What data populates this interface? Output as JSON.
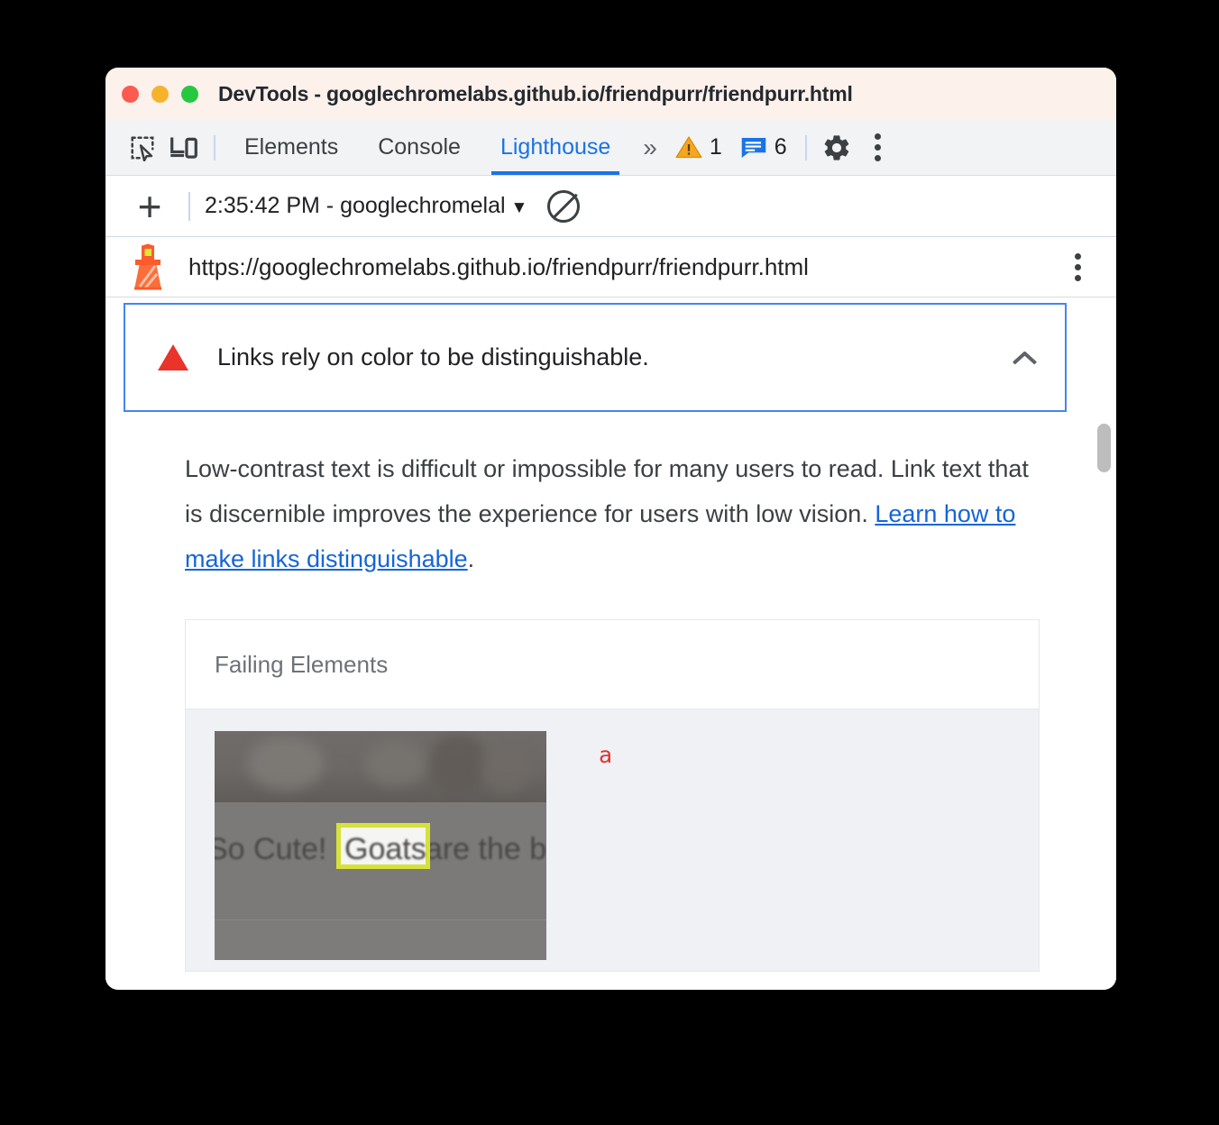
{
  "window": {
    "title": "DevTools - googlechromelabs.github.io/friendpurr/friendpurr.html",
    "traffic_lights": [
      "close",
      "minimize",
      "zoom"
    ]
  },
  "devtools_tabs": {
    "inspect_icon": "inspect-element-icon",
    "device_icon": "device-toolbar-icon",
    "items": [
      {
        "label": "Elements",
        "active": false
      },
      {
        "label": "Console",
        "active": false
      },
      {
        "label": "Lighthouse",
        "active": true
      }
    ],
    "more_tabs_icon": "chevron-double-right-icon",
    "warning_count": "1",
    "message_count": "6",
    "settings_icon": "gear-icon",
    "menu_icon": "kebab-menu-icon",
    "active_tab_color": "#1a73e8"
  },
  "lighthouse_toolbar": {
    "new_report_icon": "plus-icon",
    "report_selector_value": "2:35:42 PM - googlechromelal",
    "dropdown_caret_icon": "caret-down-icon",
    "clear_icon": "no-entry-icon"
  },
  "url_bar": {
    "logo_icon": "lighthouse-icon",
    "url": "https://googlechromelabs.github.io/friendpurr/friendpurr.html",
    "menu_icon": "kebab-menu-icon"
  },
  "audit": {
    "severity_icon": "red-warning-triangle-icon",
    "title": "Links rely on color to be distinguishable.",
    "collapse_icon": "chevron-up-icon",
    "description_before": "Low-contrast text is difficult or impossible for many users to read. Link text that is discernible improves the experience for users with low vision. ",
    "link_text": "Learn how to make links distinguishable",
    "description_after": ".",
    "border_color": "#4285f4",
    "link_color": "#1565d8"
  },
  "failing_elements": {
    "header": "Failing Elements",
    "rows": [
      {
        "thumbnail_text_prefix": "So Cute! ",
        "thumbnail_highlight": "Goats",
        "thumbnail_text_suffix": " are the b",
        "highlight_color": "#d6e13a",
        "selector": "a",
        "selector_color": "#e0342b"
      }
    ]
  },
  "scrollbar": {
    "thumb_color": "#bdbdbd"
  }
}
